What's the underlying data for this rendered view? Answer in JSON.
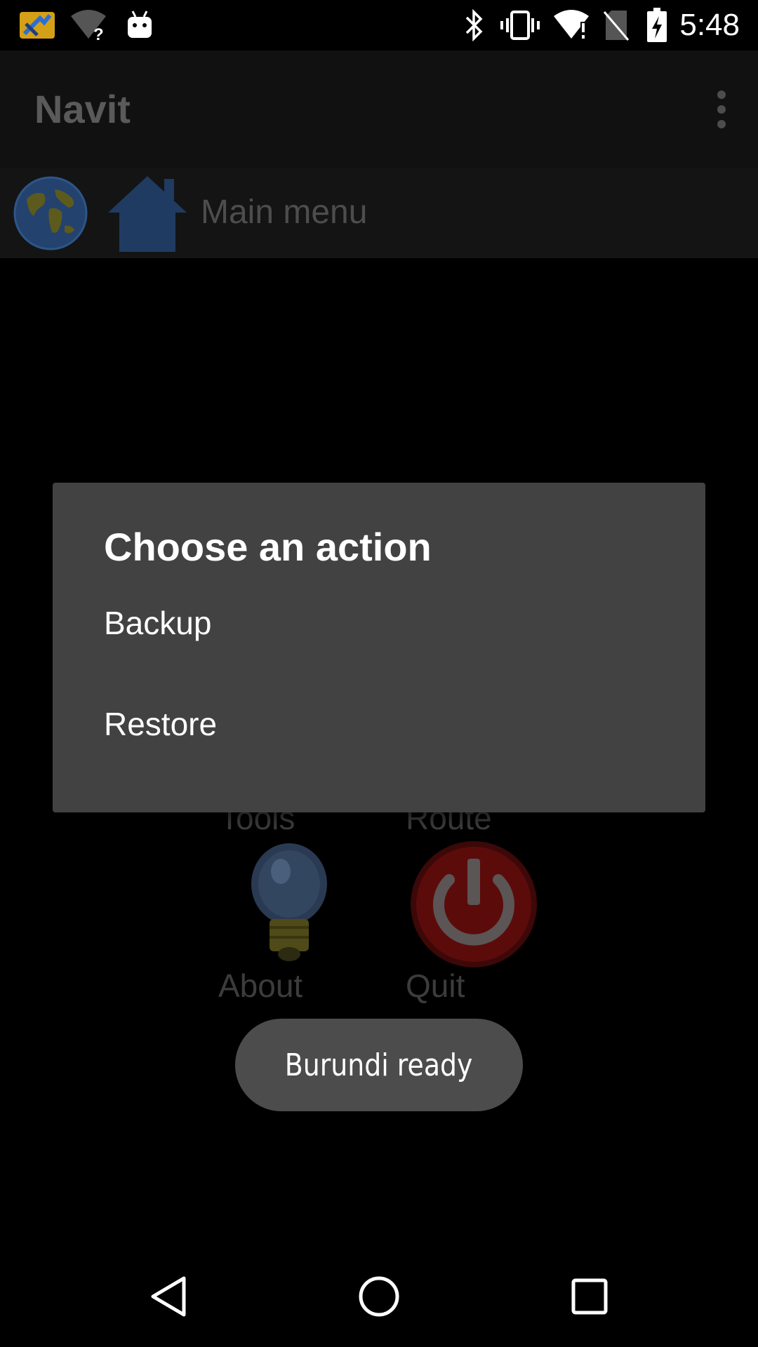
{
  "status_bar": {
    "time": "5:48",
    "icons": [
      "navit-app-icon",
      "wifi-unknown-icon",
      "android-debug-icon",
      "bluetooth-icon",
      "vibrate-icon",
      "wifi-alert-icon",
      "no-sim-icon",
      "battery-charging-icon"
    ]
  },
  "app_bar": {
    "title": "Navit",
    "overflow_icon": "more-vert-icon"
  },
  "menu_row": {
    "label": "Main menu",
    "globe_icon": "globe-icon",
    "home_icon": "home-icon"
  },
  "background_menu": {
    "tools_label": "Tools",
    "route_label": "Route",
    "about_label": "About",
    "quit_label": "Quit"
  },
  "dialog": {
    "title": "Choose an action",
    "items": [
      {
        "label": "Backup"
      },
      {
        "label": "Restore"
      }
    ]
  },
  "toast": {
    "text": "Burundi ready"
  },
  "nav_bar": {
    "back": "back-icon",
    "home": "home-circle-icon",
    "recents": "recents-icon"
  },
  "colors": {
    "dialog_bg": "#424242",
    "toast_bg": "#4c4c4c",
    "app_bar_bg": "#111111"
  }
}
